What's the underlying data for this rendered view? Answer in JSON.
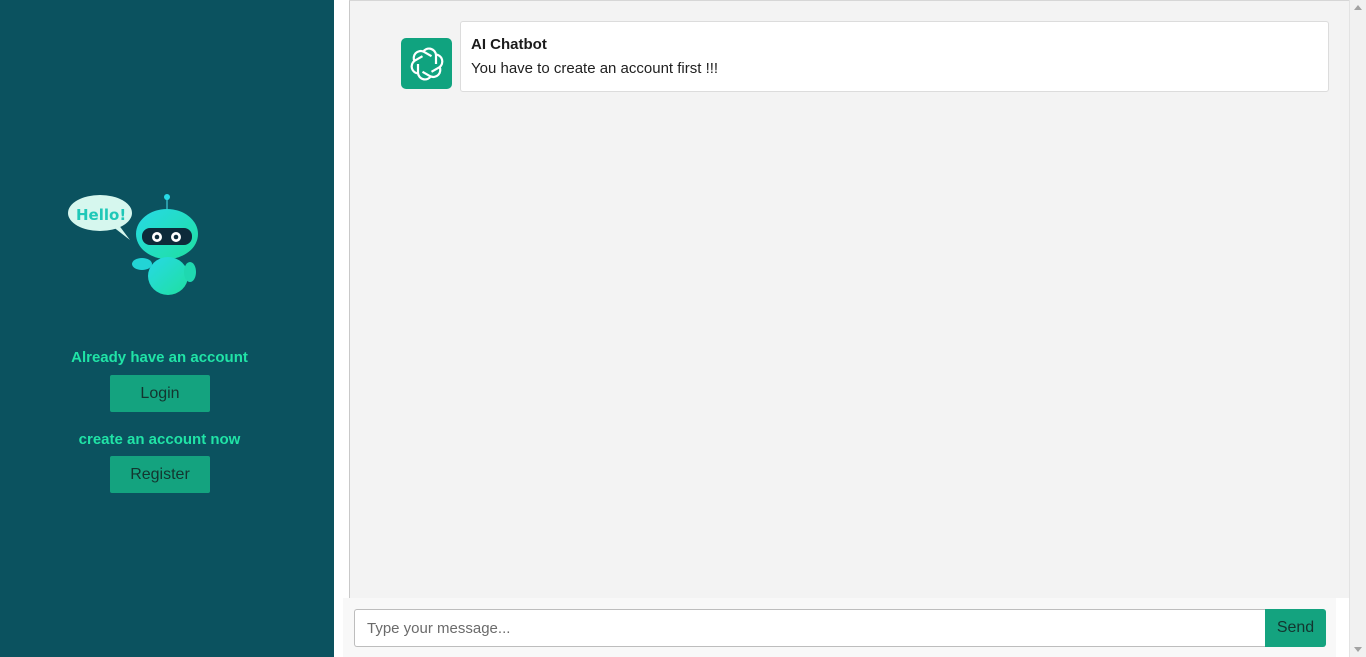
{
  "sidebar": {
    "mascot": {
      "icon": "robot-hello-mascot",
      "speech_text": "Hello!"
    },
    "login_prompt": "Already have an account",
    "login_label": "Login",
    "register_prompt": "create an account now",
    "register_label": "Register"
  },
  "chat": {
    "messages": [
      {
        "sender": "AI Chatbot",
        "text": "You have to create an account first !!!",
        "avatar_icon": "openai-logo-icon"
      }
    ]
  },
  "composer": {
    "placeholder": "Type your message...",
    "send_label": "Send"
  },
  "colors": {
    "sidebar_bg": "#0b525f",
    "accent": "#14a37f",
    "prompt_text": "#20e3a6",
    "chat_bg": "#f3f3f3"
  }
}
